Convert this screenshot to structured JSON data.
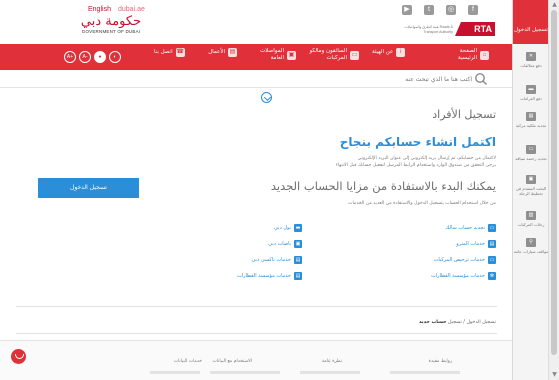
{
  "top": {
    "lang_en": "English",
    "lang_dubai": "dubai.ae",
    "gov_logo_ar": "حكومة دبي",
    "gov_logo_en": "GOVERNMENT OF DUBAI",
    "social_icons": [
      "youtube-icon",
      "twitter-icon",
      "instagram-icon",
      "facebook-icon"
    ],
    "rta_logo": "RTA",
    "rta_tagline": "هيئة الطرق والمواصلات Roads & Transport Authority"
  },
  "nav": {
    "items": [
      {
        "label": "الصفحة الرئيسية",
        "icon": "home-icon"
      },
      {
        "label": "عن الهيئة",
        "icon": "info-icon"
      },
      {
        "label": "السائقون ومالكو المركبات",
        "icon": "car-icon"
      },
      {
        "label": "المواصلات العامة",
        "icon": "bus-icon"
      },
      {
        "label": "الأعمال",
        "icon": "briefcase-icon"
      },
      {
        "label": "اتصل بنا",
        "icon": "phone-icon"
      }
    ],
    "circle_buttons": [
      "A+",
      "A-",
      "●",
      "◐"
    ]
  },
  "search": {
    "placeholder": "اكتب هنا ما الذي تبحث عنه"
  },
  "content": {
    "heading": "تسجيل الأفراد",
    "success_title": "اكتمل انشاء حسابكم بنجاح",
    "success_line1": "لاكتمال من حسابكم، تم إرسال بريد إلكتروني إلى عنوان البريد الإلكتروني",
    "success_line2": "يرجى التحقق من صندوق الوارد واستخدام الرابط المرسل لتفعيل حسابك قبل الانتهاء",
    "start_title": "يمكنك البدء بالاستفادة من مزايا الحساب الجديد",
    "start_line": "من خلال استخدام الحساب بتسجيل الدخول والاستفادة من العديد من الخدمات",
    "login_button": "تسجيل الدخول",
    "benefits_right": [
      "تجديد حساب سالك",
      "خدمات المترو",
      "خدمات ترخيص المركبات",
      "خدمات مؤسسة القطارات"
    ],
    "benefits_left": [
      "نول دبي",
      "باصات دبي",
      "خدمات تاكسي دبي",
      "خدمات مؤسسة القطارات"
    ]
  },
  "breadcrumb": {
    "prefix": "تسجيل الدخول / تسجيل",
    "current": "حساب جديد"
  },
  "footer": {
    "columns": [
      "روابط مفيدة",
      "نظرة عامة",
      "الاستخدام مع البيانات",
      "خدمات البيانات"
    ]
  },
  "sidebar": {
    "login": "تسجيل الدخول",
    "items": [
      {
        "label": "دفع مخالفات",
        "icon": "cone-icon"
      },
      {
        "label": "دفع الغرامات",
        "icon": "card-icon"
      },
      {
        "label": "تجديد ملكية مركبة",
        "icon": "doc-icon"
      },
      {
        "label": "تجديد رخصة سياقة",
        "icon": "license-icon"
      },
      {
        "label": "البحث المتقدم في تخطيط الرحلة",
        "icon": "bus-icon"
      },
      {
        "label": "رحلات المركبات",
        "icon": "id-icon"
      },
      {
        "label": "مواقف سيارات عامة",
        "icon": "pin-icon"
      }
    ]
  },
  "colors": {
    "brand_red": "#e0313a",
    "accent_blue": "#2a8fd8"
  }
}
